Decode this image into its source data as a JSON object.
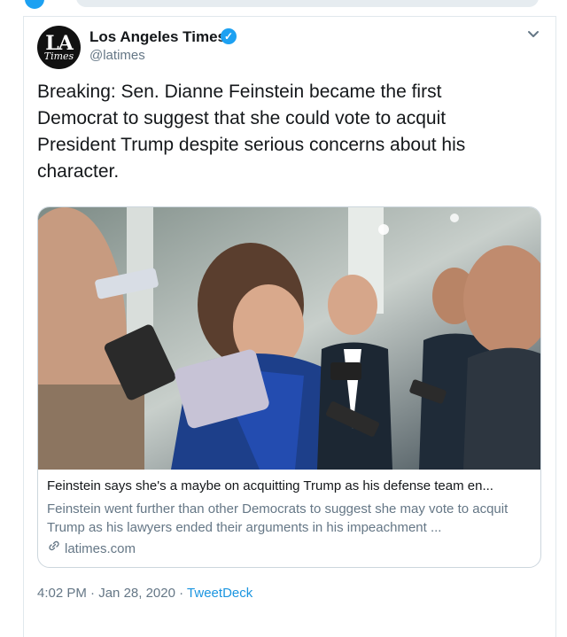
{
  "tweet": {
    "author_name": "Los Angeles Times",
    "author_handle": "@latimes",
    "avatar_text_top": "LA",
    "avatar_text_bottom": "Times",
    "text": "Breaking: Sen. Dianne Feinstein became the first Democrat to suggest that she could vote to acquit President Trump despite serious concerns about his character.",
    "card": {
      "title": "Feinstein says she's a maybe on acquitting Trump as his defense team en...",
      "description": "Feinstein went further than other Democrats to suggest she may vote to acquit Trump as his lawyers ended their arguments in his impeachment ...",
      "domain": "latimes.com"
    },
    "time": "4:02 PM",
    "date": "Jan 28, 2020",
    "separator": "·",
    "source": "TweetDeck"
  },
  "colors": {
    "accent": "#1da1f2",
    "link": "#1b95e0",
    "muted": "#657786",
    "text": "#14171a",
    "border": "#e1e8ed"
  },
  "icons": {
    "verified": "verified-badge-icon",
    "chevron": "chevron-down-icon",
    "link": "link-icon"
  }
}
